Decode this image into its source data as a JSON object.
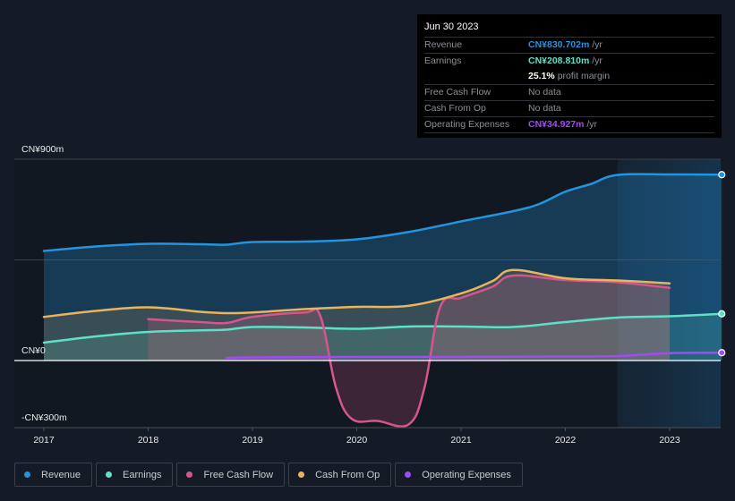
{
  "tooltip": {
    "date": "Jun 30 2023",
    "rows": [
      {
        "label": "Revenue",
        "value": "CN¥830.702m",
        "unit": " /yr",
        "color": "#2394df"
      },
      {
        "label": "Earnings",
        "value": "CN¥208.810m",
        "unit": " /yr",
        "color": "#5ee0c8"
      },
      {
        "label": "",
        "value": "25.1%",
        "unit": " profit margin",
        "color": "#ffffff"
      },
      {
        "label": "Free Cash Flow",
        "value": "",
        "unit": "No data",
        "color": "#8b9097"
      },
      {
        "label": "Cash From Op",
        "value": "",
        "unit": "No data",
        "color": "#8b9097"
      },
      {
        "label": "Operating Expenses",
        "value": "CN¥34.927m",
        "unit": " /yr",
        "color": "#a24bf2"
      }
    ]
  },
  "legend": [
    {
      "label": "Revenue",
      "color": "#2394df"
    },
    {
      "label": "Earnings",
      "color": "#5ee0c8"
    },
    {
      "label": "Free Cash Flow",
      "color": "#d5568c"
    },
    {
      "label": "Cash From Op",
      "color": "#e8b45f"
    },
    {
      "label": "Operating Expenses",
      "color": "#a24bf2"
    }
  ],
  "chart_data": {
    "type": "line",
    "title": "",
    "xlabel": "",
    "ylabel": "",
    "y_tick_labels": [
      "CN¥900m",
      "CN¥0",
      "-CN¥300m"
    ],
    "y_ticks": [
      900,
      0,
      -300
    ],
    "ylim": [
      -300,
      900
    ],
    "x_tick_labels": [
      "2017",
      "2018",
      "2019",
      "2020",
      "2021",
      "2022",
      "2023"
    ],
    "x_ticks": [
      2017,
      2018,
      2019,
      2020,
      2021,
      2022,
      2023
    ],
    "xlim": [
      2016.7,
      2023.5
    ],
    "forecast_shade_start": 2022.5,
    "grid": true,
    "series": [
      {
        "name": "Revenue",
        "color": "#2394df",
        "fill": true,
        "x": [
          2017,
          2017.5,
          2018,
          2018.5,
          2018.75,
          2019,
          2019.5,
          2020,
          2020.5,
          2021,
          2021.5,
          2021.75,
          2022,
          2022.25,
          2022.5,
          2023,
          2023.5
        ],
        "y": [
          490,
          510,
          522,
          520,
          518,
          530,
          532,
          542,
          575,
          622,
          668,
          700,
          755,
          790,
          830,
          832,
          831
        ]
      },
      {
        "name": "Earnings",
        "color": "#5ee0c8",
        "fill": true,
        "x": [
          2017,
          2017.5,
          2018,
          2018.5,
          2018.75,
          2019,
          2019.5,
          2020,
          2020.5,
          2021,
          2021.5,
          2022,
          2022.5,
          2023,
          2023.5
        ],
        "y": [
          80,
          108,
          128,
          135,
          138,
          150,
          148,
          142,
          152,
          152,
          150,
          172,
          192,
          198,
          209
        ]
      },
      {
        "name": "Free Cash Flow",
        "color": "#d5568c",
        "fill": true,
        "x": [
          2018,
          2018.5,
          2018.75,
          2019,
          2019.5,
          2019.65,
          2019.8,
          2019.95,
          2020.2,
          2020.5,
          2020.65,
          2020.8,
          2021,
          2021.3,
          2021.5,
          2022,
          2022.5,
          2023
        ],
        "y": [
          185,
          172,
          168,
          195,
          215,
          200,
          -120,
          -260,
          -270,
          -285,
          -120,
          240,
          280,
          330,
          380,
          360,
          350,
          325
        ]
      },
      {
        "name": "Cash From Op",
        "color": "#e8b45f",
        "fill": true,
        "x": [
          2017,
          2017.5,
          2018,
          2018.5,
          2018.75,
          2019,
          2019.5,
          2020,
          2020.5,
          2021,
          2021.3,
          2021.5,
          2022,
          2022.5,
          2023
        ],
        "y": [
          195,
          222,
          238,
          218,
          212,
          215,
          230,
          240,
          245,
          300,
          355,
          405,
          368,
          358,
          345
        ]
      },
      {
        "name": "Operating Expenses",
        "color": "#a24bf2",
        "fill": false,
        "x": [
          2018.75,
          2019,
          2019.5,
          2020,
          2020.5,
          2021,
          2021.5,
          2022,
          2022.5,
          2023,
          2023.5
        ],
        "y": [
          12,
          14,
          15,
          16,
          16,
          16,
          17,
          18,
          20,
          33,
          35
        ]
      }
    ]
  }
}
